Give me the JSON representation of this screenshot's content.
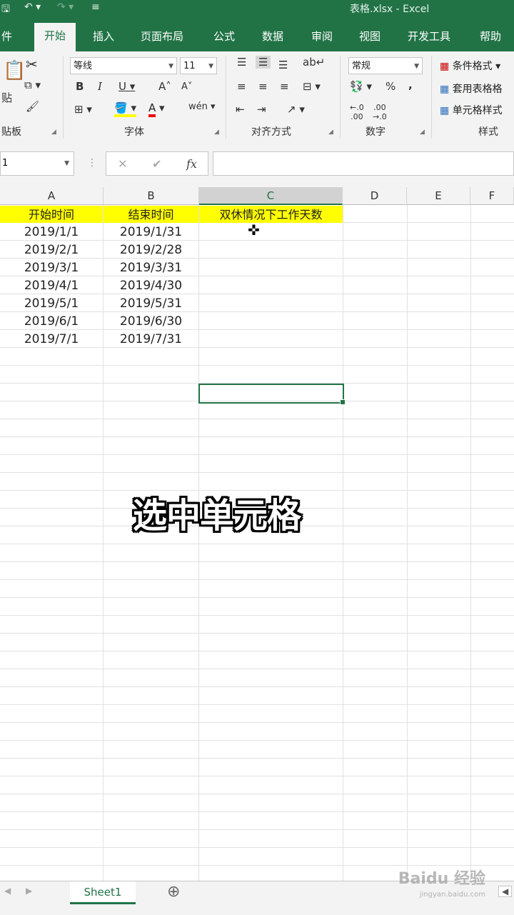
{
  "window": {
    "title": "表格.xlsx - Excel"
  },
  "tabs": [
    {
      "label": "件"
    },
    {
      "label": "开始"
    },
    {
      "label": "插入"
    },
    {
      "label": "页面布局"
    },
    {
      "label": "公式"
    },
    {
      "label": "数据"
    },
    {
      "label": "审阅"
    },
    {
      "label": "视图"
    },
    {
      "label": "开发工具"
    },
    {
      "label": "帮助"
    }
  ],
  "ribbon": {
    "clipboard": {
      "paste_label": "贴",
      "group_label": "贴板"
    },
    "font": {
      "name": "等线",
      "size": "11",
      "group_label": "字体"
    },
    "alignment": {
      "group_label": "对齐方式"
    },
    "number": {
      "format": "常规",
      "group_label": "数字"
    },
    "styles": {
      "conditional": "条件格式",
      "table": "套用表格格",
      "cell": "单元格样式",
      "group_label": "样式"
    }
  },
  "formula_bar": {
    "name_box": "1",
    "cancel": "✕",
    "enter": "✔",
    "fx": "fx",
    "value": ""
  },
  "sheet": {
    "columns": [
      "A",
      "B",
      "C",
      "D",
      "E",
      "F"
    ],
    "header_row": [
      "开始时间",
      "结束时间",
      "双休情况下工作天数"
    ],
    "rows": [
      [
        "2019/1/1",
        "2019/1/31"
      ],
      [
        "2019/2/1",
        "2019/2/28"
      ],
      [
        "2019/3/1",
        "2019/3/31"
      ],
      [
        "2019/4/1",
        "2019/4/30"
      ],
      [
        "2019/5/1",
        "2019/5/31"
      ],
      [
        "2019/6/1",
        "2019/6/30"
      ],
      [
        "2019/7/1",
        "2019/7/31"
      ]
    ]
  },
  "caption": "选中单元格",
  "sheet_tabs": {
    "active": "Sheet1",
    "add": "⊕"
  },
  "watermark": {
    "brand": "Baidu 经验",
    "url": "jingyan.baidu.com"
  },
  "colors": {
    "excel_green": "#217346",
    "header_fill": "#ffff00"
  }
}
